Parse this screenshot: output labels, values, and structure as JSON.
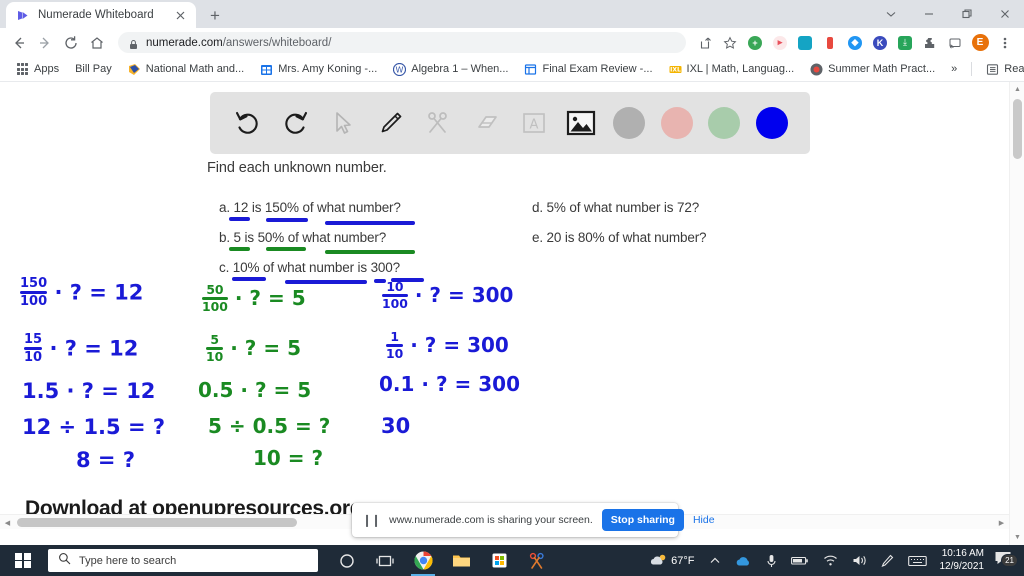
{
  "browser": {
    "tab": {
      "title": "Numerade Whiteboard",
      "favicon": "numerade-play-icon",
      "close": "close-icon"
    },
    "new_tab_label": "+",
    "window_controls": [
      "chevron-down-icon",
      "minimize-icon",
      "restore-icon",
      "close-icon"
    ],
    "nav": {
      "back": "back-arrow-icon",
      "forward": "forward-arrow-icon",
      "reload": "reload-icon",
      "home": "home-icon"
    },
    "omnibox": {
      "lock": "lock-icon",
      "domain": "numerade.com",
      "path": "/answers/whiteboard/"
    },
    "toolbar_icons": [
      "share-icon",
      "bookmark-star-icon",
      "extension-green-icon",
      "extension-pink-icon",
      "extension-teal-icon",
      "extension-red-icon",
      "extension-blue-icon",
      "extension-k-icon",
      "extension-save-icon",
      "puzzle-extensions-icon",
      "cast-icon",
      "profile-avatar-icon",
      "chrome-menu-icon"
    ],
    "profile_initial": "E"
  },
  "bookmarks": {
    "apps_label": "Apps",
    "items": [
      {
        "label": "Bill Pay",
        "icon": "blank-icon"
      },
      {
        "label": "National Math and...",
        "icon": "national-math-icon"
      },
      {
        "label": "Mrs. Amy Koning -...",
        "icon": "calendar-blue-icon"
      },
      {
        "label": "Algebra 1 – When...",
        "icon": "wordpress-icon"
      },
      {
        "label": "Final Exam Review -...",
        "icon": "window-blue-icon"
      },
      {
        "label": "IXL | Math, Languag...",
        "icon": "ixl-icon"
      },
      {
        "label": "Summer Math Pract...",
        "icon": "record-icon"
      }
    ],
    "overflow_label": "»",
    "reading_list": {
      "label": "Reading list",
      "icon": "reading-list-icon"
    }
  },
  "whiteboard": {
    "tools": [
      {
        "name": "undo-icon",
        "label": "Undo"
      },
      {
        "name": "redo-icon",
        "label": "Redo"
      },
      {
        "name": "cursor-select-icon",
        "label": "Select"
      },
      {
        "name": "pencil-icon",
        "label": "Pen"
      },
      {
        "name": "scissors-icon",
        "label": "Cut"
      },
      {
        "name": "eraser-icon",
        "label": "Eraser"
      },
      {
        "name": "text-box-icon",
        "label": "Text"
      },
      {
        "name": "image-icon",
        "label": "Image"
      }
    ],
    "colors": [
      {
        "name": "color-swatch-gray",
        "hex": "#b0b0b0"
      },
      {
        "name": "color-swatch-pink",
        "hex": "#e8b4b0"
      },
      {
        "name": "color-swatch-green",
        "hex": "#a8ccab"
      },
      {
        "name": "color-swatch-blue",
        "hex": "#0000ee"
      }
    ],
    "selected_color": "#0000ee"
  },
  "worksheet": {
    "prompt": "Find each unknown number.",
    "left_questions": [
      "a. 12 is 150% of what number?",
      "b. 5 is 50% of what number?",
      "c. 10% of what number is 300?"
    ],
    "right_questions": [
      "d. 5% of what number is 72?",
      "e. 20 is 80% of what number?"
    ],
    "footer": "Download at openupresources.org"
  },
  "annotations": {
    "ink_blue": "#1a1ad6",
    "ink_green": "#1a8a22",
    "column_a": {
      "color": "#1a1ad6",
      "lines": [
        {
          "frac_num": "150",
          "frac_den": "100",
          "rest": "· ? = 12"
        },
        {
          "frac_num": "15",
          "frac_den": "10",
          "rest": "· ? = 12"
        },
        {
          "text": "1.5 · ? = 12"
        },
        {
          "text": "12 ÷ 1.5 = ?"
        },
        {
          "text": "8 = ?"
        }
      ]
    },
    "column_b": {
      "color": "#1a8a22",
      "lines": [
        {
          "frac_num": "50",
          "frac_den": "100",
          "rest": "· ? = 5"
        },
        {
          "frac_num": "5",
          "frac_den": "10",
          "rest": "· ? = 5"
        },
        {
          "text": "0.5 · ? = 5"
        },
        {
          "text": "5 ÷ 0.5 = ?"
        },
        {
          "text": "10 = ?"
        }
      ]
    },
    "column_c": {
      "color": "#1a1ad6",
      "lines": [
        {
          "frac_num": "10",
          "frac_den": "100",
          "rest": "· ? = 300"
        },
        {
          "frac_num": "1",
          "frac_den": "10",
          "rest": "· ? = 300"
        },
        {
          "text": "0.1 · ? = 300"
        },
        {
          "text": "30"
        }
      ]
    }
  },
  "share_bar": {
    "pause_icon": "pause-icon",
    "message": "www.numerade.com is sharing your screen.",
    "stop_label": "Stop sharing",
    "hide_label": "Hide"
  },
  "taskbar": {
    "start_icon": "windows-start-icon",
    "search_placeholder": "Type here to search",
    "search_icon": "search-icon",
    "items": [
      {
        "name": "cortana-icon"
      },
      {
        "name": "task-view-icon"
      },
      {
        "name": "chrome-icon"
      },
      {
        "name": "file-explorer-icon"
      },
      {
        "name": "microsoft-store-icon"
      },
      {
        "name": "snip-sketch-icon"
      }
    ],
    "weather": "67°F",
    "tray": [
      "show-hidden-icons",
      "onedrive-icon",
      "microphone-icon",
      "battery-icon",
      "wifi-icon",
      "volume-icon",
      "pen-icon",
      "keyboard-icon"
    ],
    "time": "10:16 AM",
    "date": "12/9/2021",
    "notifications_count": "21"
  }
}
